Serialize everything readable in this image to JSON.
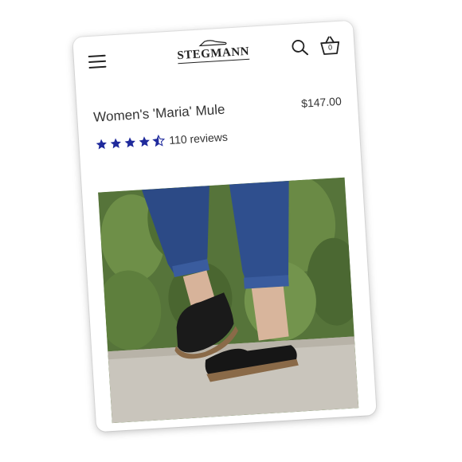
{
  "header": {
    "brand": "STEGMANN",
    "cart_count": "0",
    "icons": [
      "menu-icon",
      "search-icon",
      "basket-icon"
    ]
  },
  "product": {
    "title": "Women's 'Maria' Mule",
    "price": "$147.00",
    "rating": 4.5,
    "rating_max": 5,
    "review_count_text": "110 reviews",
    "image_subject": "black leather clog mules worn with cuffed blue jeans in front of cactus plants"
  },
  "colors": {
    "star": "#1f2a9c",
    "text": "#333333",
    "icon": "#222222"
  }
}
